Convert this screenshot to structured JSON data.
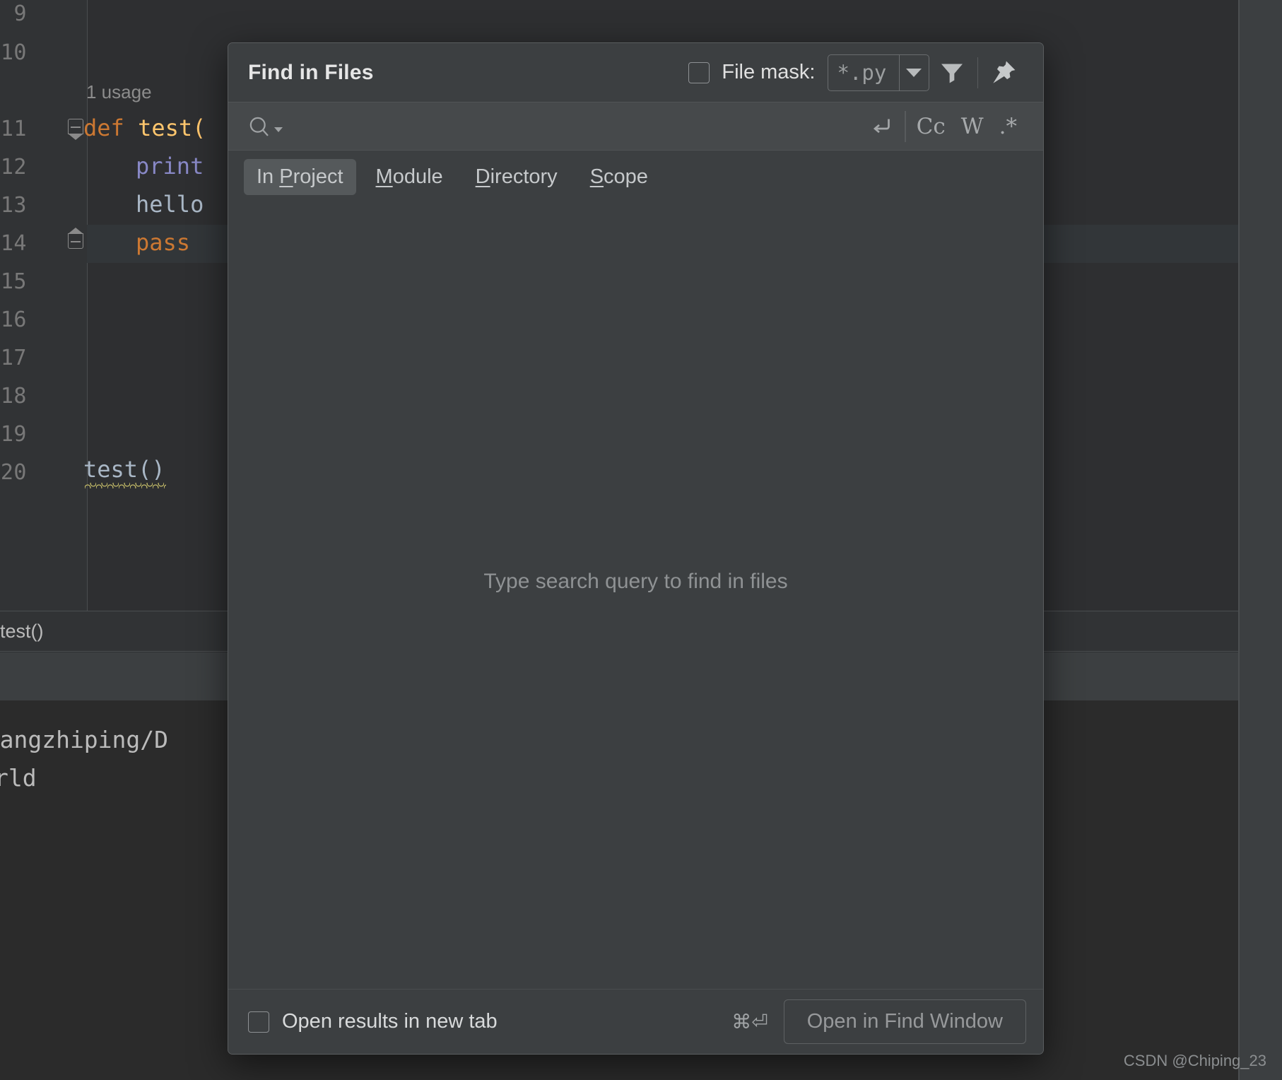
{
  "editor": {
    "line_numbers": [
      "9",
      "10",
      "11",
      "12",
      "13",
      "14",
      "15",
      "16",
      "17",
      "18",
      "19",
      "20"
    ],
    "usage_hint": "1 usage",
    "code": {
      "def_keyword": "def ",
      "def_name": "test(",
      "print_call": "print",
      "hello_text": "hello",
      "pass_keyword": "pass",
      "call_line": "test()"
    },
    "breadcrumb": "test()",
    "console": {
      "line1": "ouyangzhiping/D",
      "line2": "rld",
      "line3": ")"
    }
  },
  "dialog": {
    "title": "Find in Files",
    "file_mask": {
      "label": "File mask:",
      "value": "*.py",
      "checked": false
    },
    "icons": {
      "filter": "filter-icon",
      "pin": "pin-icon",
      "search": "search-icon",
      "multiline": "multiline-icon"
    },
    "search": {
      "value": "",
      "placeholder": ""
    },
    "search_toggles": [
      {
        "name": "match-case-toggle",
        "label": "Cc"
      },
      {
        "name": "words-toggle",
        "label": "W"
      },
      {
        "name": "regex-toggle",
        "label": ".*"
      }
    ],
    "tabs": [
      {
        "name": "tab-in-project",
        "pre": "In ",
        "mnemonic": "P",
        "post": "roject",
        "active": true
      },
      {
        "name": "tab-module",
        "pre": "",
        "mnemonic": "M",
        "post": "odule",
        "active": false
      },
      {
        "name": "tab-directory",
        "pre": "",
        "mnemonic": "D",
        "post": "irectory",
        "active": false
      },
      {
        "name": "tab-scope",
        "pre": "",
        "mnemonic": "S",
        "post": "cope",
        "active": false
      }
    ],
    "empty_message": "Type search query to find in files",
    "footer": {
      "new_tab_label": "Open results in new tab",
      "new_tab_checked": false,
      "shortcut": "⌘⏎",
      "open_button": "Open in Find Window"
    }
  },
  "watermark": "CSDN @Chiping_23",
  "colors": {
    "dialog_bg": "#3c3f41",
    "editor_bg": "#2e2f31",
    "keyword": "#cc7832",
    "function": "#ffc66d",
    "builtin": "#8888c6",
    "identifier": "#a9b7c6",
    "warning_underline": "#c9c06a"
  }
}
